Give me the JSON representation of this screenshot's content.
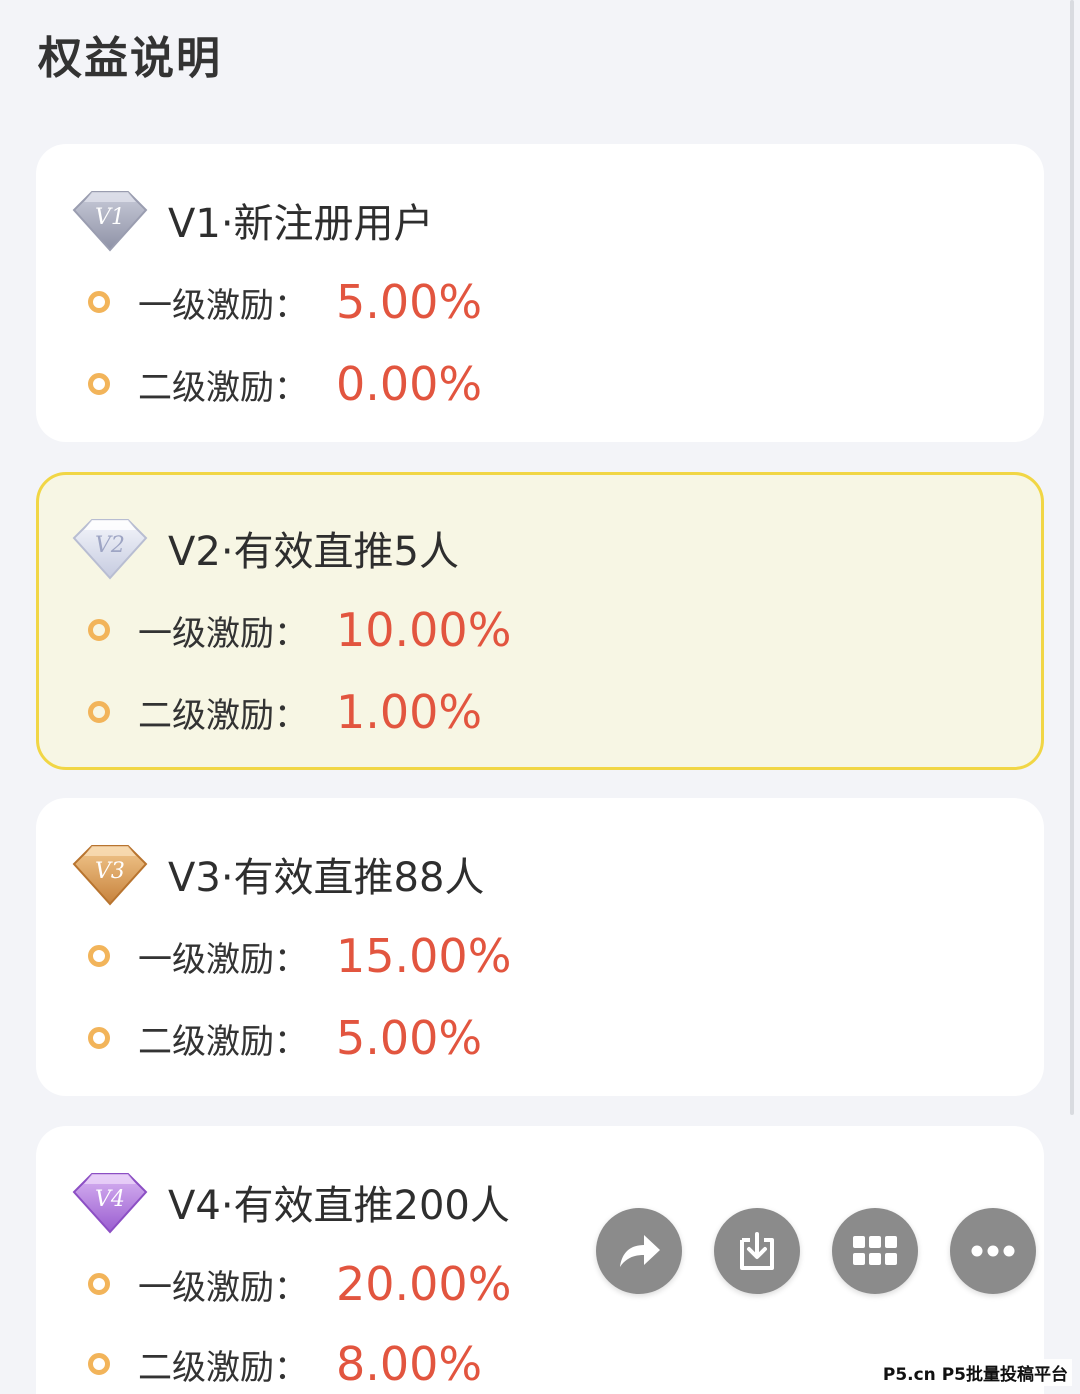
{
  "page": {
    "title": "权益说明"
  },
  "colors": {
    "background": "#f3f4f8",
    "card": "#ffffff",
    "active_card_bg": "#f7f6e4",
    "active_card_border": "#f1d645",
    "value_red": "#e2553f",
    "dot_orange": "#f2b45a",
    "fab_gray": "#8b8b8b"
  },
  "levels": [
    {
      "title": "V1·新注册用户",
      "badge_icon": "silver-diamond-v1-icon",
      "badge_label": "V1",
      "active": false,
      "rows": [
        {
          "label": "一级激励：",
          "value": "5.00%"
        },
        {
          "label": "二级激励：",
          "value": "0.00%"
        }
      ]
    },
    {
      "title": "V2·有效直推5人",
      "badge_icon": "white-diamond-v2-icon",
      "badge_label": "V2",
      "active": true,
      "rows": [
        {
          "label": "一级激励：",
          "value": "10.00%"
        },
        {
          "label": "二级激励：",
          "value": "1.00%"
        }
      ]
    },
    {
      "title": "V3·有效直推88人",
      "badge_icon": "bronze-diamond-v3-icon",
      "badge_label": "V3",
      "active": false,
      "rows": [
        {
          "label": "一级激励：",
          "value": "15.00%"
        },
        {
          "label": "二级激励：",
          "value": "5.00%"
        }
      ]
    },
    {
      "title": "V4·有效直推200人",
      "badge_icon": "purple-diamond-v4-icon",
      "badge_label": "V4",
      "active": false,
      "rows": [
        {
          "label": "一级激励：",
          "value": "20.00%"
        },
        {
          "label": "二级激励：",
          "value": "8.00%"
        }
      ]
    }
  ],
  "floating_actions": [
    {
      "icon": "share-arrow-icon"
    },
    {
      "icon": "download-icon"
    },
    {
      "icon": "grid-icon"
    },
    {
      "icon": "more-icon"
    }
  ],
  "watermark": "P5.cn P5批量投稿平台"
}
